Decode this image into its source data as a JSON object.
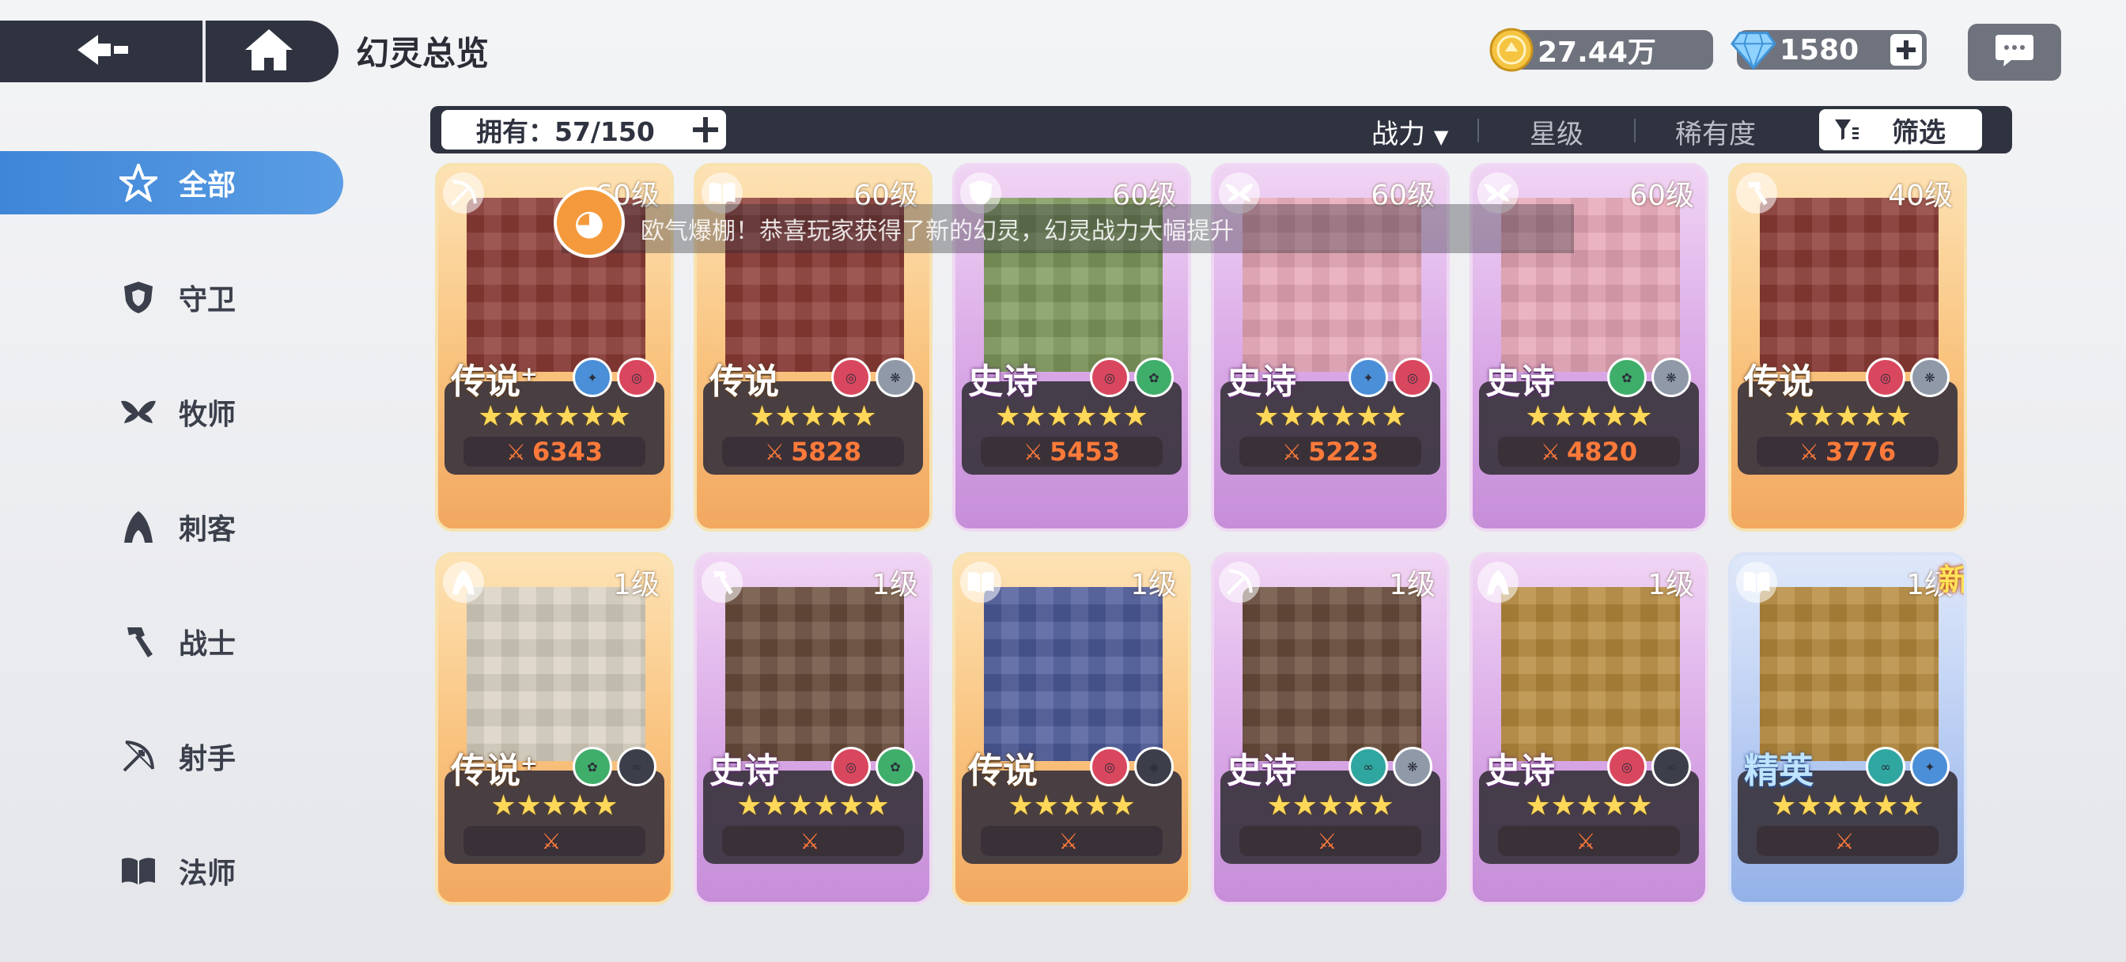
{
  "header": {
    "title": "幻灵总览",
    "gold": "27.44万",
    "gems": "1580"
  },
  "sidebar": {
    "items": [
      {
        "label": "全部",
        "icon": "all-star-icon",
        "active": true
      },
      {
        "label": "守卫",
        "icon": "shield-icon"
      },
      {
        "label": "牧师",
        "icon": "wings-icon"
      },
      {
        "label": "刺客",
        "icon": "hood-icon"
      },
      {
        "label": "战士",
        "icon": "hammer-icon"
      },
      {
        "label": "射手",
        "icon": "bow-icon"
      },
      {
        "label": "法师",
        "icon": "book-icon"
      }
    ]
  },
  "filter": {
    "owned_label": "拥有：57/150",
    "sort_power": "战力",
    "sort_star": "星级",
    "sort_rarity": "稀有度",
    "filter_label": "筛选"
  },
  "toast": {
    "text": "欧气爆棚！恭喜玩家获得了新的幻灵，幻灵战力大幅提升"
  },
  "cards": [
    {
      "level": "60级",
      "rarity": "传说",
      "plus": "+",
      "stars": "★★★★★★",
      "power": "6343",
      "class": "bow-icon",
      "tier": "legend"
    },
    {
      "level": "60级",
      "rarity": "传说",
      "plus": "",
      "stars": "★★★★★",
      "power": "5828",
      "class": "book-icon",
      "tier": "legend"
    },
    {
      "level": "60级",
      "rarity": "史诗",
      "plus": "",
      "stars": "★★★★★★",
      "power": "5453",
      "class": "shield-icon",
      "tier": "epic"
    },
    {
      "level": "60级",
      "rarity": "史诗",
      "plus": "",
      "stars": "★★★★★★",
      "power": "5223",
      "class": "wings-icon",
      "tier": "epic"
    },
    {
      "level": "60级",
      "rarity": "史诗",
      "plus": "",
      "stars": "★★★★★",
      "power": "4820",
      "class": "wings-icon",
      "tier": "epic"
    },
    {
      "level": "40级",
      "rarity": "传说",
      "plus": "",
      "stars": "★★★★★",
      "power": "3776",
      "class": "hammer-icon",
      "tier": "legend"
    },
    {
      "level": "1级",
      "rarity": "传说",
      "plus": "+",
      "stars": "★★★★★",
      "power": "",
      "class": "hood-icon",
      "tier": "legend"
    },
    {
      "level": "1级",
      "rarity": "史诗",
      "plus": "",
      "stars": "★★★★★★",
      "power": "",
      "class": "hammer-icon",
      "tier": "epic"
    },
    {
      "level": "1级",
      "rarity": "传说",
      "plus": "",
      "stars": "★★★★★",
      "power": "",
      "class": "book-icon",
      "tier": "legend"
    },
    {
      "level": "1级",
      "rarity": "史诗",
      "plus": "",
      "stars": "★★★★★",
      "power": "",
      "class": "bow-icon",
      "tier": "epic"
    },
    {
      "level": "1级",
      "rarity": "史诗",
      "plus": "",
      "stars": "★★★★★",
      "power": "",
      "class": "hood-icon",
      "tier": "epic"
    },
    {
      "level": "1级",
      "rarity": "精英",
      "plus": "",
      "stars": "★★★★★★",
      "power": "",
      "class": "book-icon",
      "tier": "elite",
      "new": "新"
    }
  ],
  "colors": {
    "accent": "#4a90dc",
    "dark_bar": "#2f3340",
    "power_text": "#ff7a3a",
    "star": "#ffd85a"
  }
}
